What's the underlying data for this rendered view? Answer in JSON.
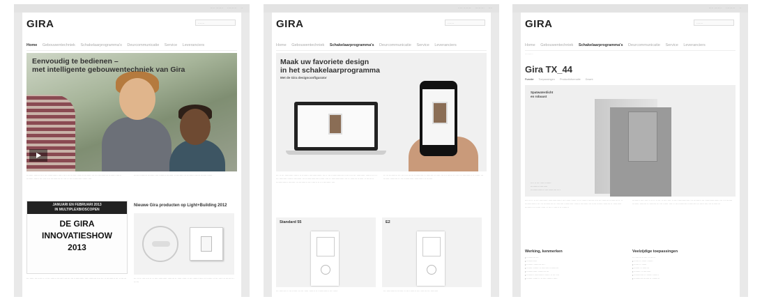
{
  "frame1": {
    "logo": "GIRA",
    "nav": [
      "Home",
      "Gebouwentechniek",
      "Schakelaarprogramma's",
      "Deurcommunicatie",
      "Service",
      "Leveranciers"
    ],
    "nav_active": 0,
    "hero_title_line1": "Eenvoudig te bedienen –",
    "hero_title_line2": "met intelligente gebouwentechniek van Gira",
    "sign_top_line1": "JANUARI EN FEBRUARI 2013",
    "sign_top_line2": "IN MULTIPLEXBIOSCOPEN",
    "sign_main_line1": "DE GIRA",
    "sign_main_line2": "INNOVATIESHOW",
    "sign_main_line3": "2013",
    "news_title": "Nieuwe Gira producten op Light+Building 2012"
  },
  "frame2": {
    "logo": "GIRA",
    "nav": [
      "Home",
      "Gebouwentechniek",
      "Schakelaarprogramma's",
      "Deurcommunicatie",
      "Service",
      "Leveranciers"
    ],
    "nav_active": 2,
    "hero_title_line1": "Maak uw favoriete design",
    "hero_title_line2": "in het schakelaarprogramma",
    "hero_sub": "Met de Gira designconfigurator",
    "card1_title": "Standard 55",
    "card2_title": "E2"
  },
  "frame3": {
    "logo": "GIRA",
    "nav": [
      "Home",
      "Gebouwentechniek",
      "Schakelaarprogramma's",
      "Deurcommunicatie",
      "Service",
      "Leveranciers"
    ],
    "nav_active": 2,
    "page_title": "Gira TX_44",
    "subnav": [
      "Functie",
      "Toepassingen",
      "Productinformatie",
      "Downl."
    ],
    "hero_label_line1": "Spatwaterdicht",
    "hero_label_line2": "en robuust",
    "sec1_title": "Werking, kenmerken",
    "sec2_title": "Veelzijdige toepassingen"
  }
}
